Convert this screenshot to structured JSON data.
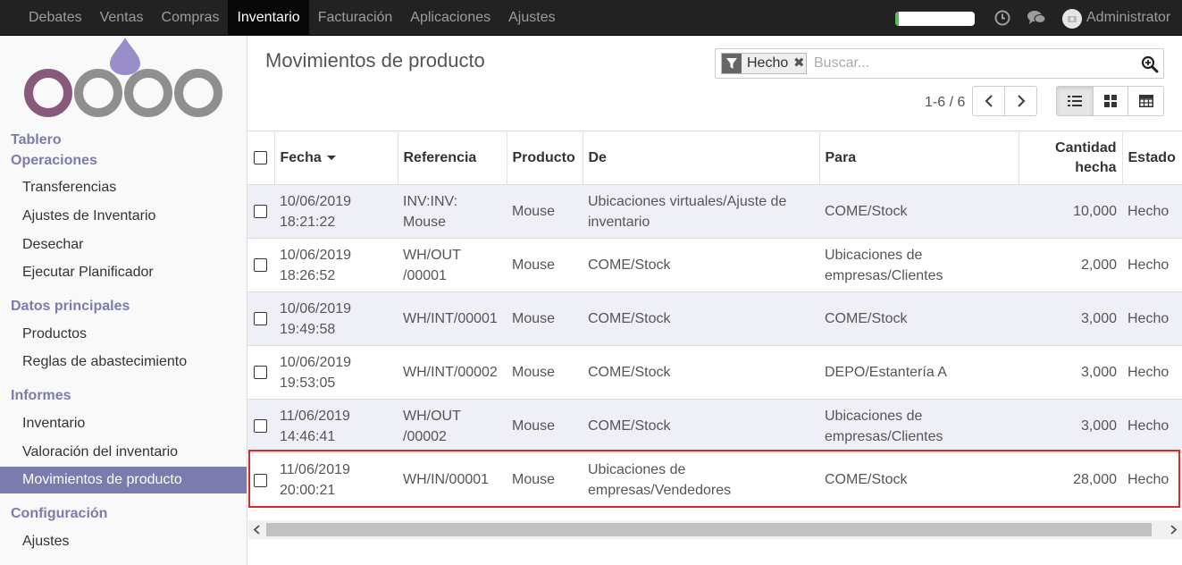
{
  "topbar": {
    "menu": [
      {
        "label": "Debates",
        "active": false
      },
      {
        "label": "Ventas",
        "active": false
      },
      {
        "label": "Compras",
        "active": false
      },
      {
        "label": "Inventario",
        "active": true
      },
      {
        "label": "Facturación",
        "active": false
      },
      {
        "label": "Aplicaciones",
        "active": false
      },
      {
        "label": "Ajustes",
        "active": false
      }
    ],
    "progress_fraction": 0.05,
    "user_name": "Administrator",
    "icons": [
      "clock-icon",
      "chat-icon",
      "avatar"
    ]
  },
  "sidebar": {
    "sections": [
      {
        "label": "Tablero",
        "items": []
      },
      {
        "label": "Operaciones",
        "items": [
          "Transferencias",
          "Ajustes de Inventario",
          "Desechar",
          "Ejecutar Planificador"
        ]
      },
      {
        "label": "Datos principales",
        "items": [
          "Productos",
          "Reglas de abastecimiento"
        ]
      },
      {
        "label": "Informes",
        "items": [
          "Inventario",
          "Valoración del inventario",
          "Movimientos de producto"
        ]
      },
      {
        "label": "Configuración",
        "items": [
          "Ajustes"
        ]
      }
    ],
    "active_item": "Movimientos de producto"
  },
  "control_panel": {
    "title": "Movimientos de producto",
    "search": {
      "facet": "Hecho",
      "placeholder": "Buscar..."
    },
    "pager": "1-6 / 6",
    "active_view": "list"
  },
  "table": {
    "columns": [
      "Fecha",
      "Referencia",
      "Producto",
      "De",
      "Para",
      "Cantidad hecha",
      "Estado"
    ],
    "rows": [
      {
        "fecha": "10/06/2019\n18:21:22",
        "referencia": "INV:INV:\nMouse",
        "producto": "Mouse",
        "de": "Ubicaciones virtuales/Ajuste de\ninventario",
        "para": "COME/Stock",
        "cantidad": "10,000",
        "estado": "Hecho"
      },
      {
        "fecha": "10/06/2019\n18:26:52",
        "referencia": "WH/OUT\n/00001",
        "producto": "Mouse",
        "de": "COME/Stock",
        "para": "Ubicaciones de\nempresas/Clientes",
        "cantidad": "2,000",
        "estado": "Hecho"
      },
      {
        "fecha": "10/06/2019\n19:49:58",
        "referencia": "WH/INT/00001",
        "producto": "Mouse",
        "de": "COME/Stock",
        "para": "COME/Stock",
        "cantidad": "3,000",
        "estado": "Hecho"
      },
      {
        "fecha": "10/06/2019\n19:53:05",
        "referencia": "WH/INT/00002",
        "producto": "Mouse",
        "de": "COME/Stock",
        "para": "DEPO/Estantería A",
        "cantidad": "3,000",
        "estado": "Hecho"
      },
      {
        "fecha": "11/06/2019\n14:46:41",
        "referencia": "WH/OUT\n/00002",
        "producto": "Mouse",
        "de": "COME/Stock",
        "para": "Ubicaciones de\nempresas/Clientes",
        "cantidad": "3,000",
        "estado": "Hecho"
      },
      {
        "fecha": "11/06/2019\n20:00:21",
        "referencia": "WH/IN/00001",
        "producto": "Mouse",
        "de": "Ubicaciones de\nempresas/Vendedores",
        "para": "COME/Stock",
        "cantidad": "28,000",
        "estado": "Hecho"
      }
    ]
  },
  "colors": {
    "brand": "#7c7bad",
    "highlight": "#d9272e",
    "progress": "#5cb85c"
  }
}
